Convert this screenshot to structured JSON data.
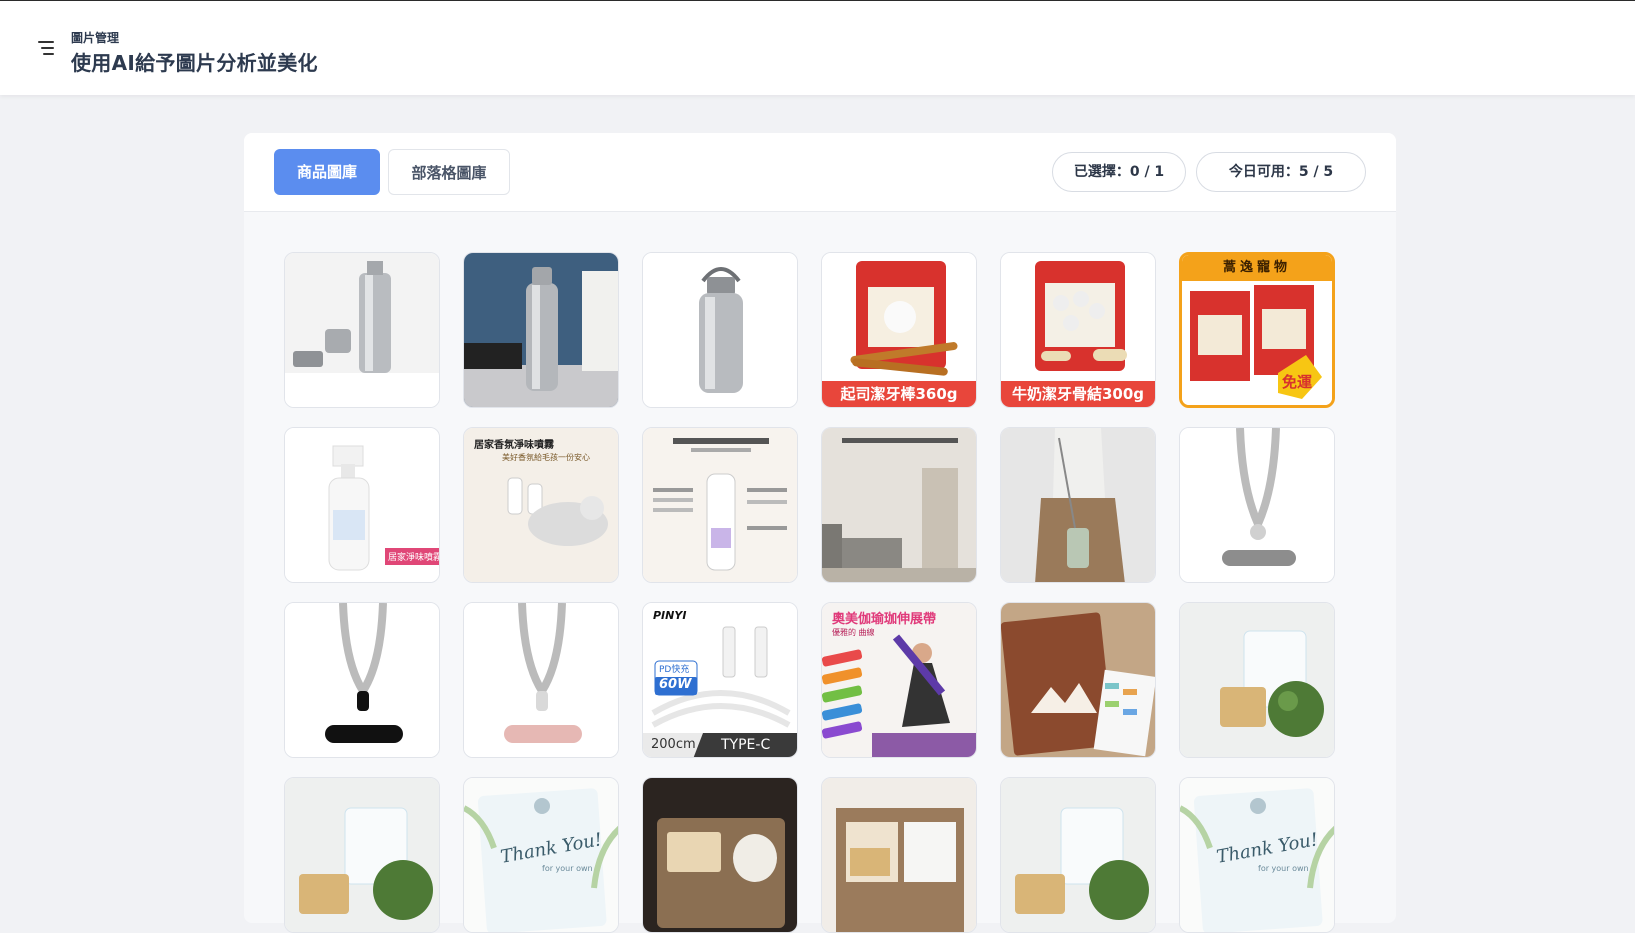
{
  "header": {
    "breadcrumb": "圖片管理",
    "title": "使用AI給予圖片分析並美化"
  },
  "tabs": [
    {
      "label": "商品圖庫",
      "active": true
    },
    {
      "label": "部落格圖庫",
      "active": false
    }
  ],
  "status": {
    "selected": "已選擇：0 / 1",
    "available": "今日可用：5 / 5"
  },
  "colors": {
    "accent": "#5b8def",
    "caption_red": "#e8463b",
    "banner_orange": "#f4a21a"
  },
  "gallery": {
    "captions": {
      "cheese_sticks": "起司潔牙棒360g",
      "milk_bones": "牛奶潔牙骨結300g",
      "pet_store": "蒿逸寵物",
      "free_shipping": "免運",
      "deodorant_tag": "居家淨味噴霧",
      "spray_title": "居家香氛淨味噴霧",
      "spray_sub": "美好香氛給毛孩一份安心",
      "cable_brand": "PINYI",
      "cable_pd": "PD快充",
      "cable_watt": "60W",
      "cable_len": "200cm",
      "cable_type": "TYPE-C",
      "yoga_title": "奧美伽瑜珈伸展帶",
      "yoga_sub": "優雅的 曲線",
      "thank_you": "Thank You!",
      "for_you": "for your own"
    }
  }
}
